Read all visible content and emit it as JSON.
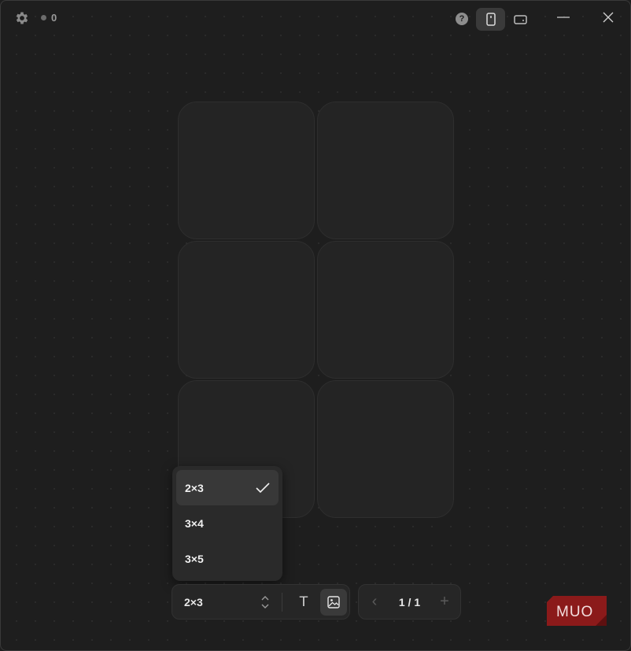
{
  "titlebar": {
    "counter": "0",
    "help_label": "?"
  },
  "layout_menu": {
    "options": [
      {
        "label": "2×3",
        "selected": true
      },
      {
        "label": "3×4",
        "selected": false
      },
      {
        "label": "3×5",
        "selected": false
      }
    ]
  },
  "toolbar": {
    "layout_value": "2×3",
    "text_tool": "T"
  },
  "pager": {
    "page": "1 / 1",
    "prev": "‹",
    "next": "+"
  },
  "watermark": {
    "text": "MUO",
    "color": "#8b1a1a"
  },
  "colors": {
    "background": "#1e1e1e",
    "cell": "#242424",
    "menu": "#2a2a2a"
  }
}
